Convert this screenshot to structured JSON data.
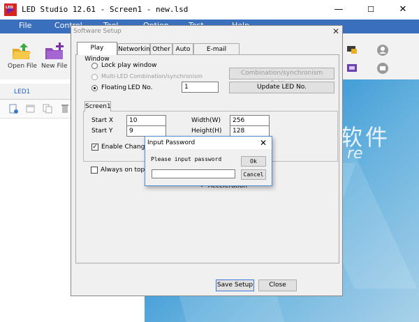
{
  "app": {
    "title": "LED Studio 12.61 - Screen1 - new.lsd",
    "icon_letters": "LED",
    "window_controls": [
      "—",
      "☐",
      "✕"
    ]
  },
  "menu": [
    "File",
    "Control",
    "Tool",
    "Option",
    "Test",
    "Help"
  ],
  "toolbar": {
    "open_label": "Open File",
    "new_label": "New File"
  },
  "led_tab": "LED1",
  "background_brand": {
    "zh": "软件",
    "en": "re"
  },
  "setup": {
    "title": "Software Setup",
    "close": "✕",
    "tabs": [
      "Play Window",
      "Networking",
      "Other",
      "Auto",
      "E-mail settings"
    ],
    "active_tab": "Play Window",
    "lock_play_window": "Lock play window",
    "multi_led": "Multi-LED Combination/synchronism",
    "floating": "Floating",
    "led_no_label": "LED No.",
    "led_no_value": "1",
    "combination_button": "Combination/synchronism Setting",
    "update_button": "Update LED No.",
    "screen_tab": "Screen1",
    "start_x_label": "Start X",
    "start_x_value": "10",
    "start_y_label": "Start Y",
    "start_y_value": "9",
    "width_label": "Width(W)",
    "width_value": "256",
    "height_label": "Height(H)",
    "height_value": "128",
    "enable_change": "Enable Change E",
    "always_on_top": "Always on top",
    "acceleration": "Acceleration",
    "save_button": "Save Setup",
    "close_button": "Close"
  },
  "password_dialog": {
    "title": "Input Password",
    "close": "✕",
    "prompt": "Please input password",
    "input_value": "",
    "ok": "Ok",
    "cancel": "Cancel"
  },
  "colors": {
    "menubar": "#3a6fbd",
    "accent": "#4d8dd6"
  }
}
